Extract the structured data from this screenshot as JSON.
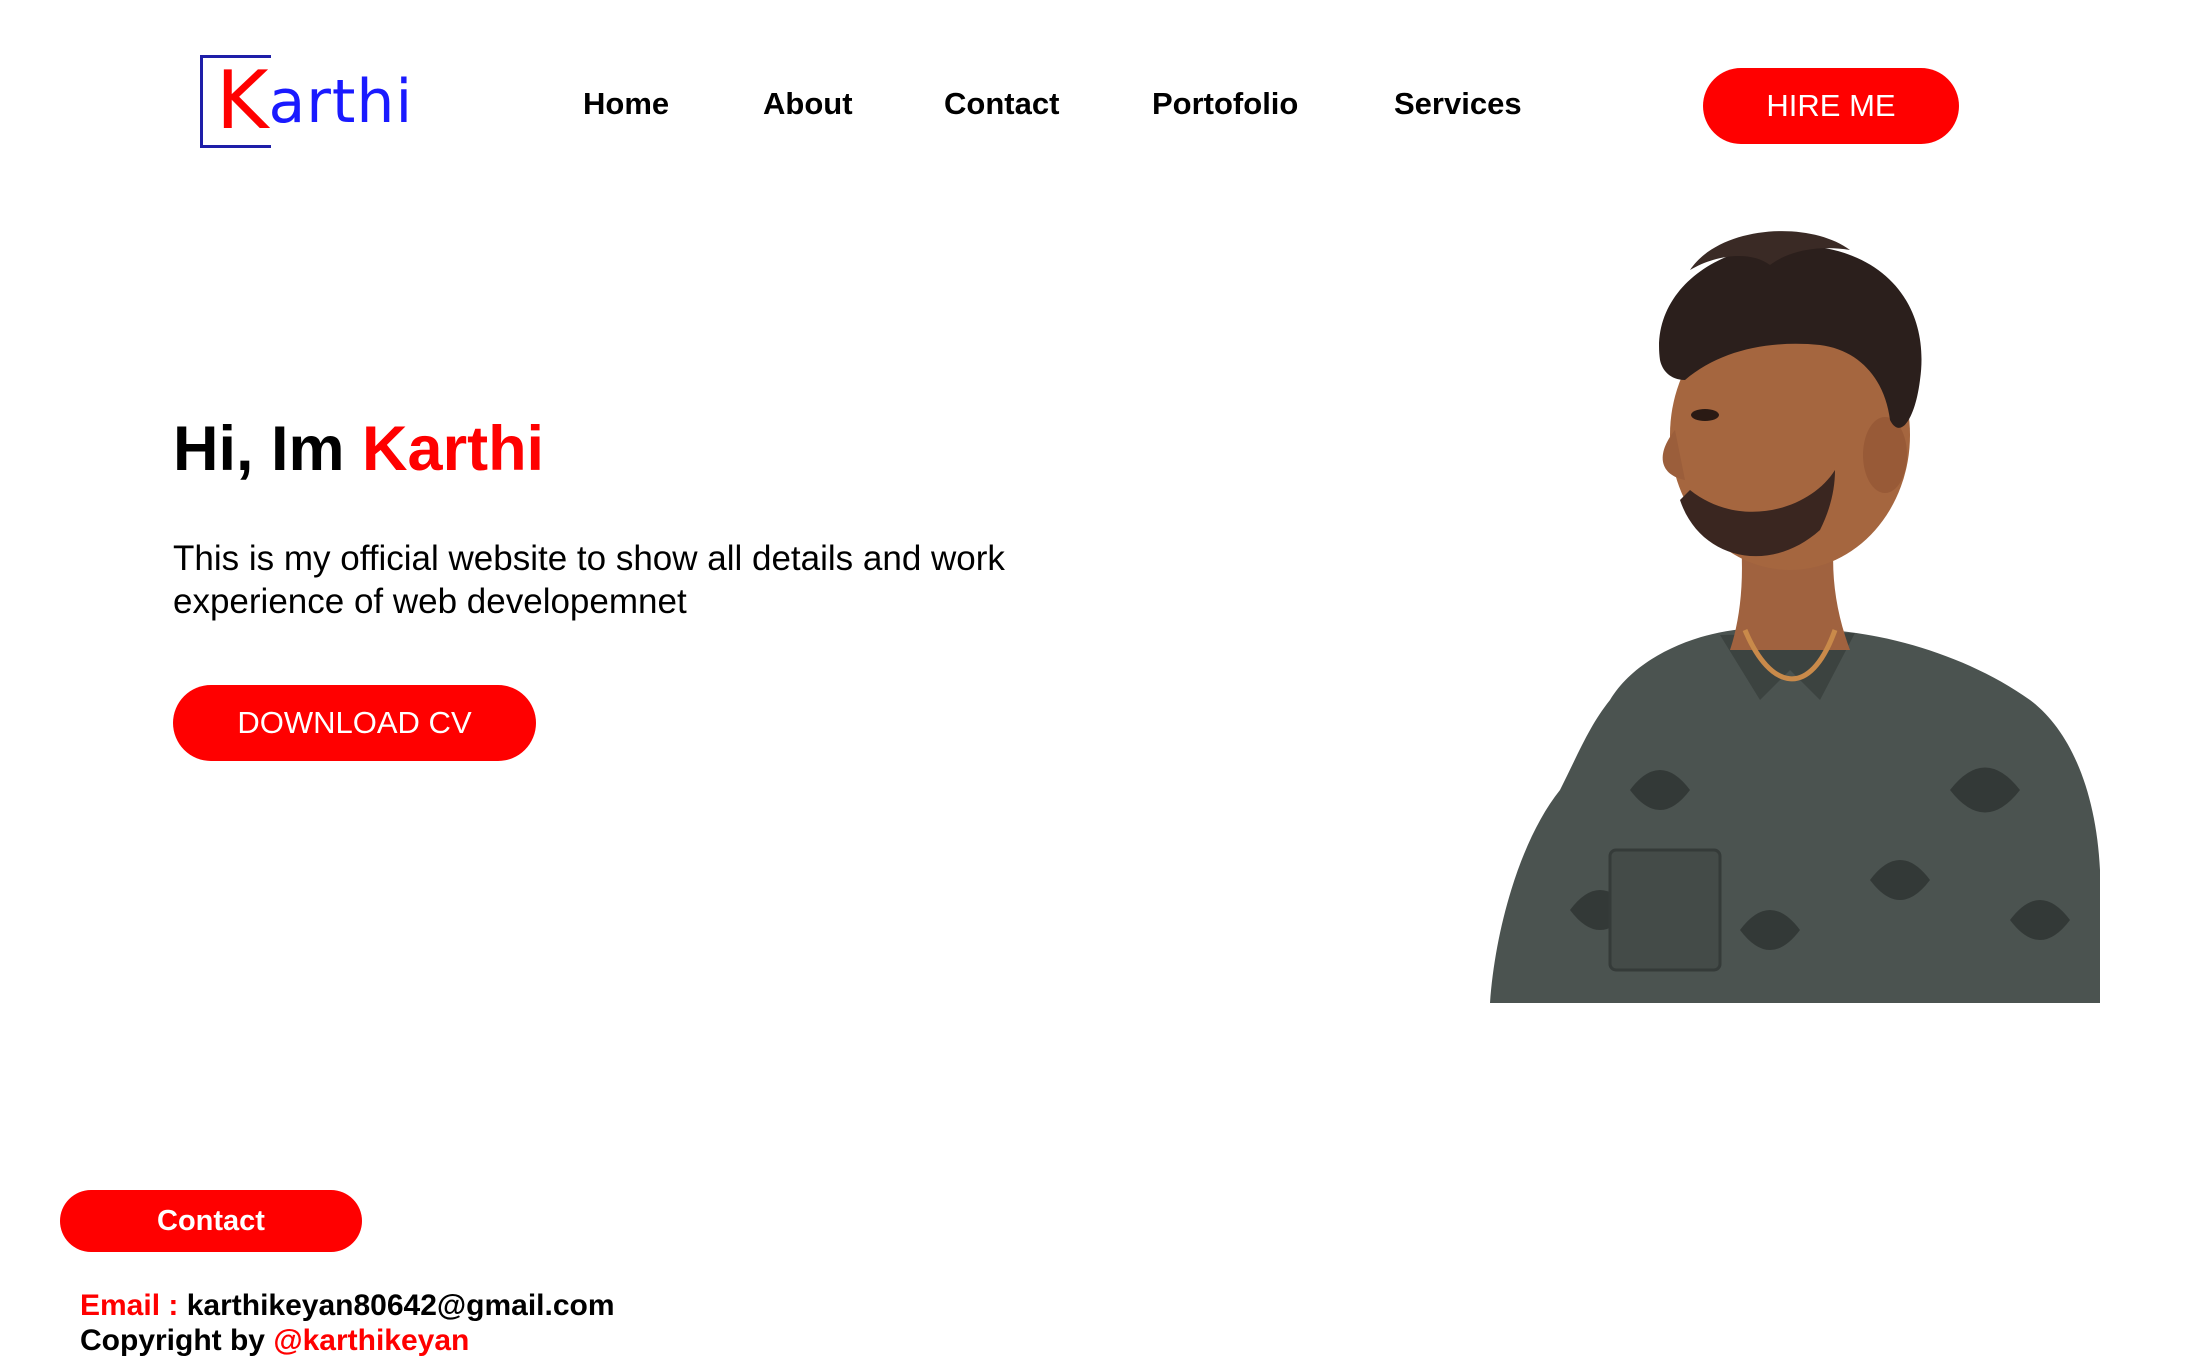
{
  "brand": {
    "logo_initial": "K",
    "logo_rest": "arthi",
    "accent_color": "#ff0000",
    "logo_color": "#1a1aff"
  },
  "nav": {
    "items": [
      {
        "label": "Home"
      },
      {
        "label": "About"
      },
      {
        "label": "Contact"
      },
      {
        "label": "Portofolio"
      },
      {
        "label": "Services"
      }
    ],
    "hire_label": "HIRE ME"
  },
  "hero": {
    "greeting": "Hi, Im",
    "name": "Karthi",
    "description": "This is my official website to show all details and work experience of web developemnet",
    "download_label": "DOWNLOAD CV",
    "portrait_icon": "person-portrait-icon"
  },
  "footer": {
    "contact_label": "Contact",
    "email_label": "Email :",
    "email_value": "karthikeyan80642@gmail.com",
    "copyright_label": "Copyright by",
    "copyright_handle": "@karthikeyan"
  }
}
